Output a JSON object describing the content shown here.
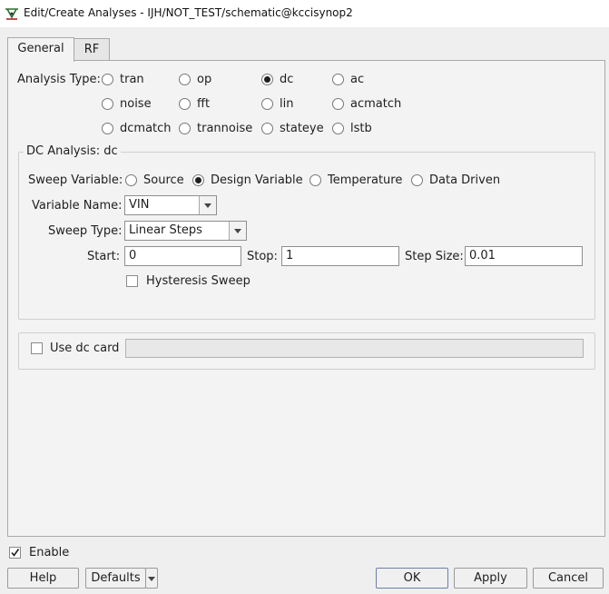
{
  "window": {
    "title": "Edit/Create Analyses - IJH/NOT_TEST/schematic@kccisynop2"
  },
  "tabs": [
    {
      "label": "General"
    },
    {
      "label": "RF"
    }
  ],
  "analysis_type": {
    "label": "Analysis Type:",
    "options": [
      "tran",
      "op",
      "dc",
      "ac",
      "noise",
      "fft",
      "lin",
      "acmatch",
      "dcmatch",
      "trannoise",
      "stateye",
      "lstb"
    ],
    "selected": "dc"
  },
  "dc_analysis": {
    "title": "DC Analysis: dc",
    "sweep_variable": {
      "label": "Sweep Variable:",
      "options": [
        "Source",
        "Design Variable",
        "Temperature",
        "Data Driven"
      ],
      "selected": "Design Variable"
    },
    "variable_name": {
      "label": "Variable Name:",
      "value": "VIN"
    },
    "sweep_type": {
      "label": "Sweep Type:",
      "value": "Linear Steps"
    },
    "start": {
      "label": "Start:",
      "value": "0"
    },
    "stop": {
      "label": "Stop:",
      "value": "1"
    },
    "step_size": {
      "label": "Step Size:",
      "value": "0.01"
    },
    "hysteresis": {
      "label": "Hysteresis Sweep",
      "checked": false
    }
  },
  "dc_card": {
    "label": "Use dc card",
    "checked": false,
    "value": ""
  },
  "enable": {
    "label": "Enable",
    "checked": true
  },
  "buttons": {
    "help": "Help",
    "defaults": "Defaults",
    "ok": "OK",
    "apply": "Apply",
    "cancel": "Cancel"
  }
}
